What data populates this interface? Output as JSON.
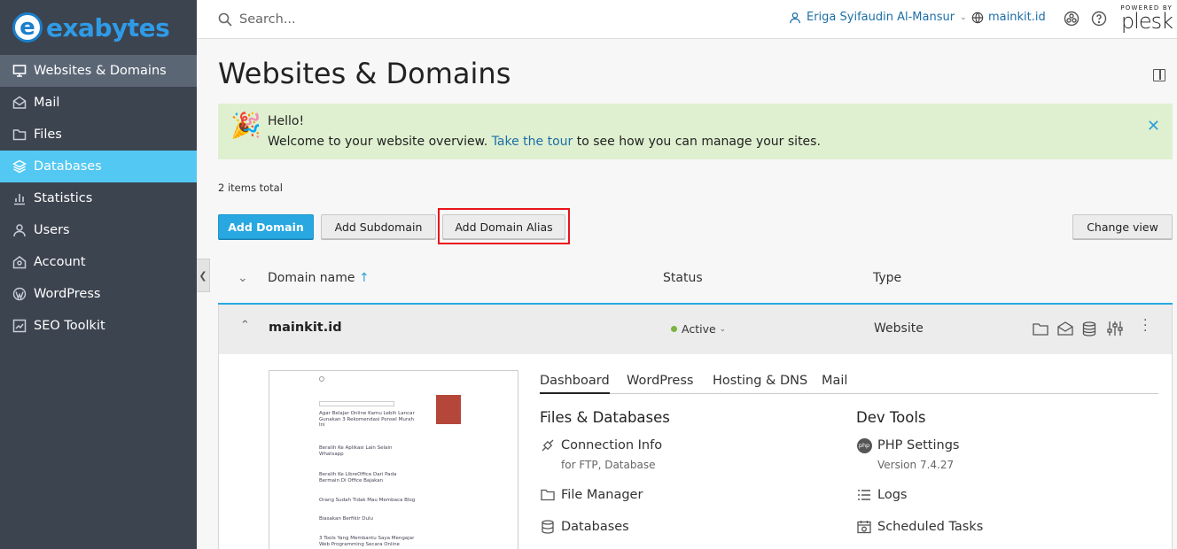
{
  "brand": {
    "logo_letter": "e",
    "logo_word": "exabytes"
  },
  "sidebar": {
    "items": [
      {
        "label": "Websites & Domains",
        "icon": "monitor-icon"
      },
      {
        "label": "Mail",
        "icon": "envelope-icon"
      },
      {
        "label": "Files",
        "icon": "folder-icon"
      },
      {
        "label": "Databases",
        "icon": "database-icon"
      },
      {
        "label": "Statistics",
        "icon": "bar-chart-icon"
      },
      {
        "label": "Users",
        "icon": "user-icon"
      },
      {
        "label": "Account",
        "icon": "account-icon"
      },
      {
        "label": "WordPress",
        "icon": "wordpress-icon"
      },
      {
        "label": "SEO Toolkit",
        "icon": "seo-chart-icon"
      }
    ]
  },
  "topbar": {
    "search_placeholder": "Search...",
    "user_name": "Eriga Syifaudin Al-Mansur",
    "site_name": "mainkit.id",
    "powered_by": "POWERED BY",
    "plesk": "plesk"
  },
  "page": {
    "title": "Websites & Domains"
  },
  "banner": {
    "greeting": "Hello!",
    "text_before": "Welcome to your website overview.",
    "link": "Take the tour",
    "text_after": "to see how you can manage your sites."
  },
  "list": {
    "count": "2 items total"
  },
  "toolbar": {
    "add_domain": "Add Domain",
    "add_subdomain": "Add Subdomain",
    "add_domain_alias": "Add Domain Alias",
    "change_view": "Change view"
  },
  "table": {
    "headers": {
      "domain": "Domain name",
      "status": "Status",
      "type": "Type"
    },
    "rows": [
      {
        "domain": "mainkit.id",
        "status": "Active",
        "type": "Website"
      }
    ]
  },
  "detail": {
    "tabs": [
      "Dashboard",
      "WordPress",
      "Hosting & DNS",
      "Mail"
    ],
    "files_section": "Files & Databases",
    "connection_info": "Connection Info",
    "connection_sub": "for FTP, Database",
    "file_manager": "File Manager",
    "databases": "Databases",
    "dev_section": "Dev Tools",
    "php_settings": "PHP Settings",
    "php_version": "Version 7.4.27",
    "logs": "Logs",
    "scheduled_tasks": "Scheduled Tasks"
  },
  "preview": {
    "posts": [
      "Agar Belajar Online Kamu Lebih Lancar Gunakan 3 Rekomendasi Ponsel Murah Ini",
      "Beralih Ke Aplikasi Lain Selain Whatsapp",
      "Beralih Ke LibreOffice Dari Pada Bermain Di Office Bajakan",
      "Orang Sudah Tidak Mau Membaca Blog",
      "Biasakan Berfikir Dulu",
      "3 Tools Yang Membantu Saya Mengajar Web Programming Secara Online"
    ]
  }
}
